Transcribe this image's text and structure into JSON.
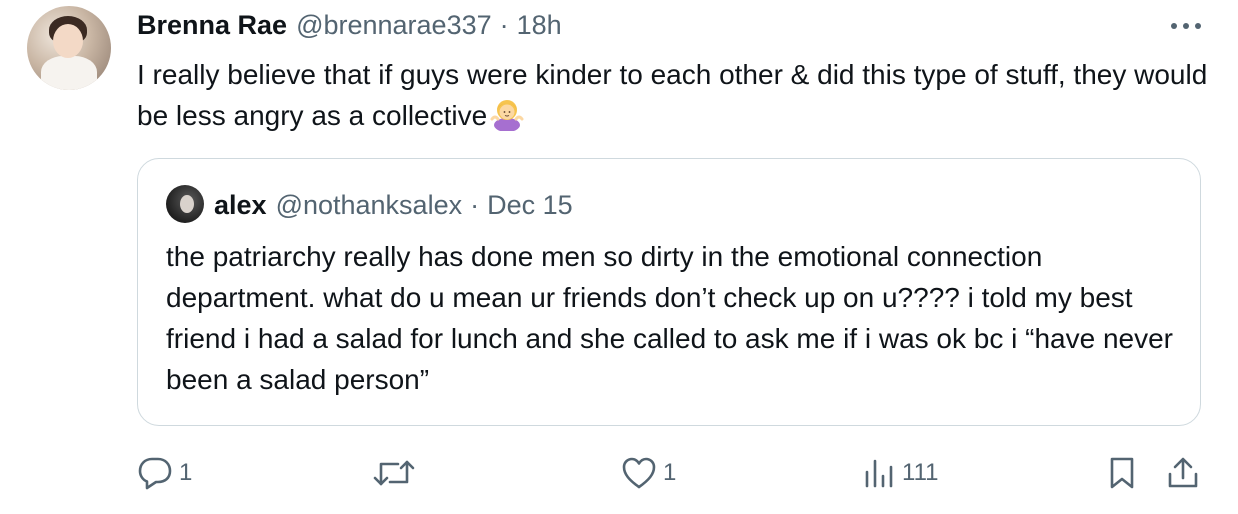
{
  "post": {
    "author_name": "Brenna Rae",
    "author_handle": "@brennarae337",
    "separator": "·",
    "time": "18h",
    "text": "I really believe that if guys were kinder to each other & did this type of stuff, they would be less angry as a collective",
    "emoji_icon": "person-shrugging-emoji"
  },
  "quote": {
    "author_name": "alex",
    "author_handle": "@nothanksalex",
    "separator": "·",
    "date": "Dec 15",
    "text": "the patriarchy really has done men so dirty in the emotional connection department. what do u mean ur friends don’t check up on u???? i told my best friend i had a salad for lunch and she called to ask me if i was ok bc i “have never been a salad person”"
  },
  "actions": {
    "reply_count": "1",
    "retweet_count": "",
    "like_count": "1",
    "views_count": "111"
  },
  "colors": {
    "text_primary": "#0f1419",
    "text_secondary": "#536471",
    "border": "#cfd9de"
  }
}
